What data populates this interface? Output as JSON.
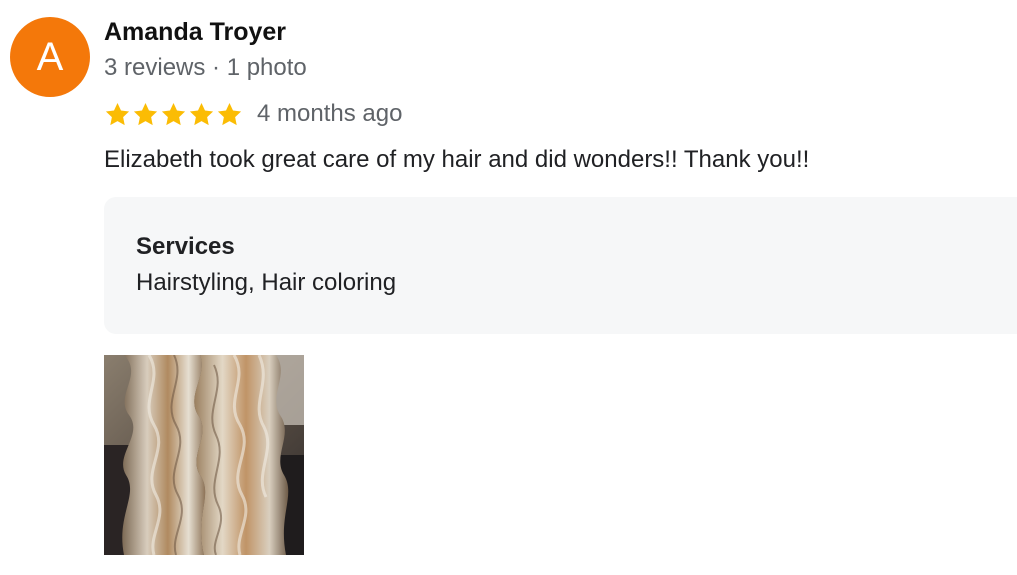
{
  "review": {
    "author": {
      "initial": "A",
      "name": "Amanda Troyer",
      "meta": "3 reviews · 1 photo",
      "avatar_color": "#f4780a"
    },
    "rating": 5,
    "max_rating": 5,
    "star_color": "#fbbc04",
    "date": "4 months ago",
    "text": "Elizabeth took great care of my hair and did wonders!! Thank you!!",
    "services": {
      "title": "Services",
      "value": "Hairstyling, Hair coloring"
    },
    "photos": [
      {
        "subject": "wavy balayage hair"
      }
    ]
  }
}
